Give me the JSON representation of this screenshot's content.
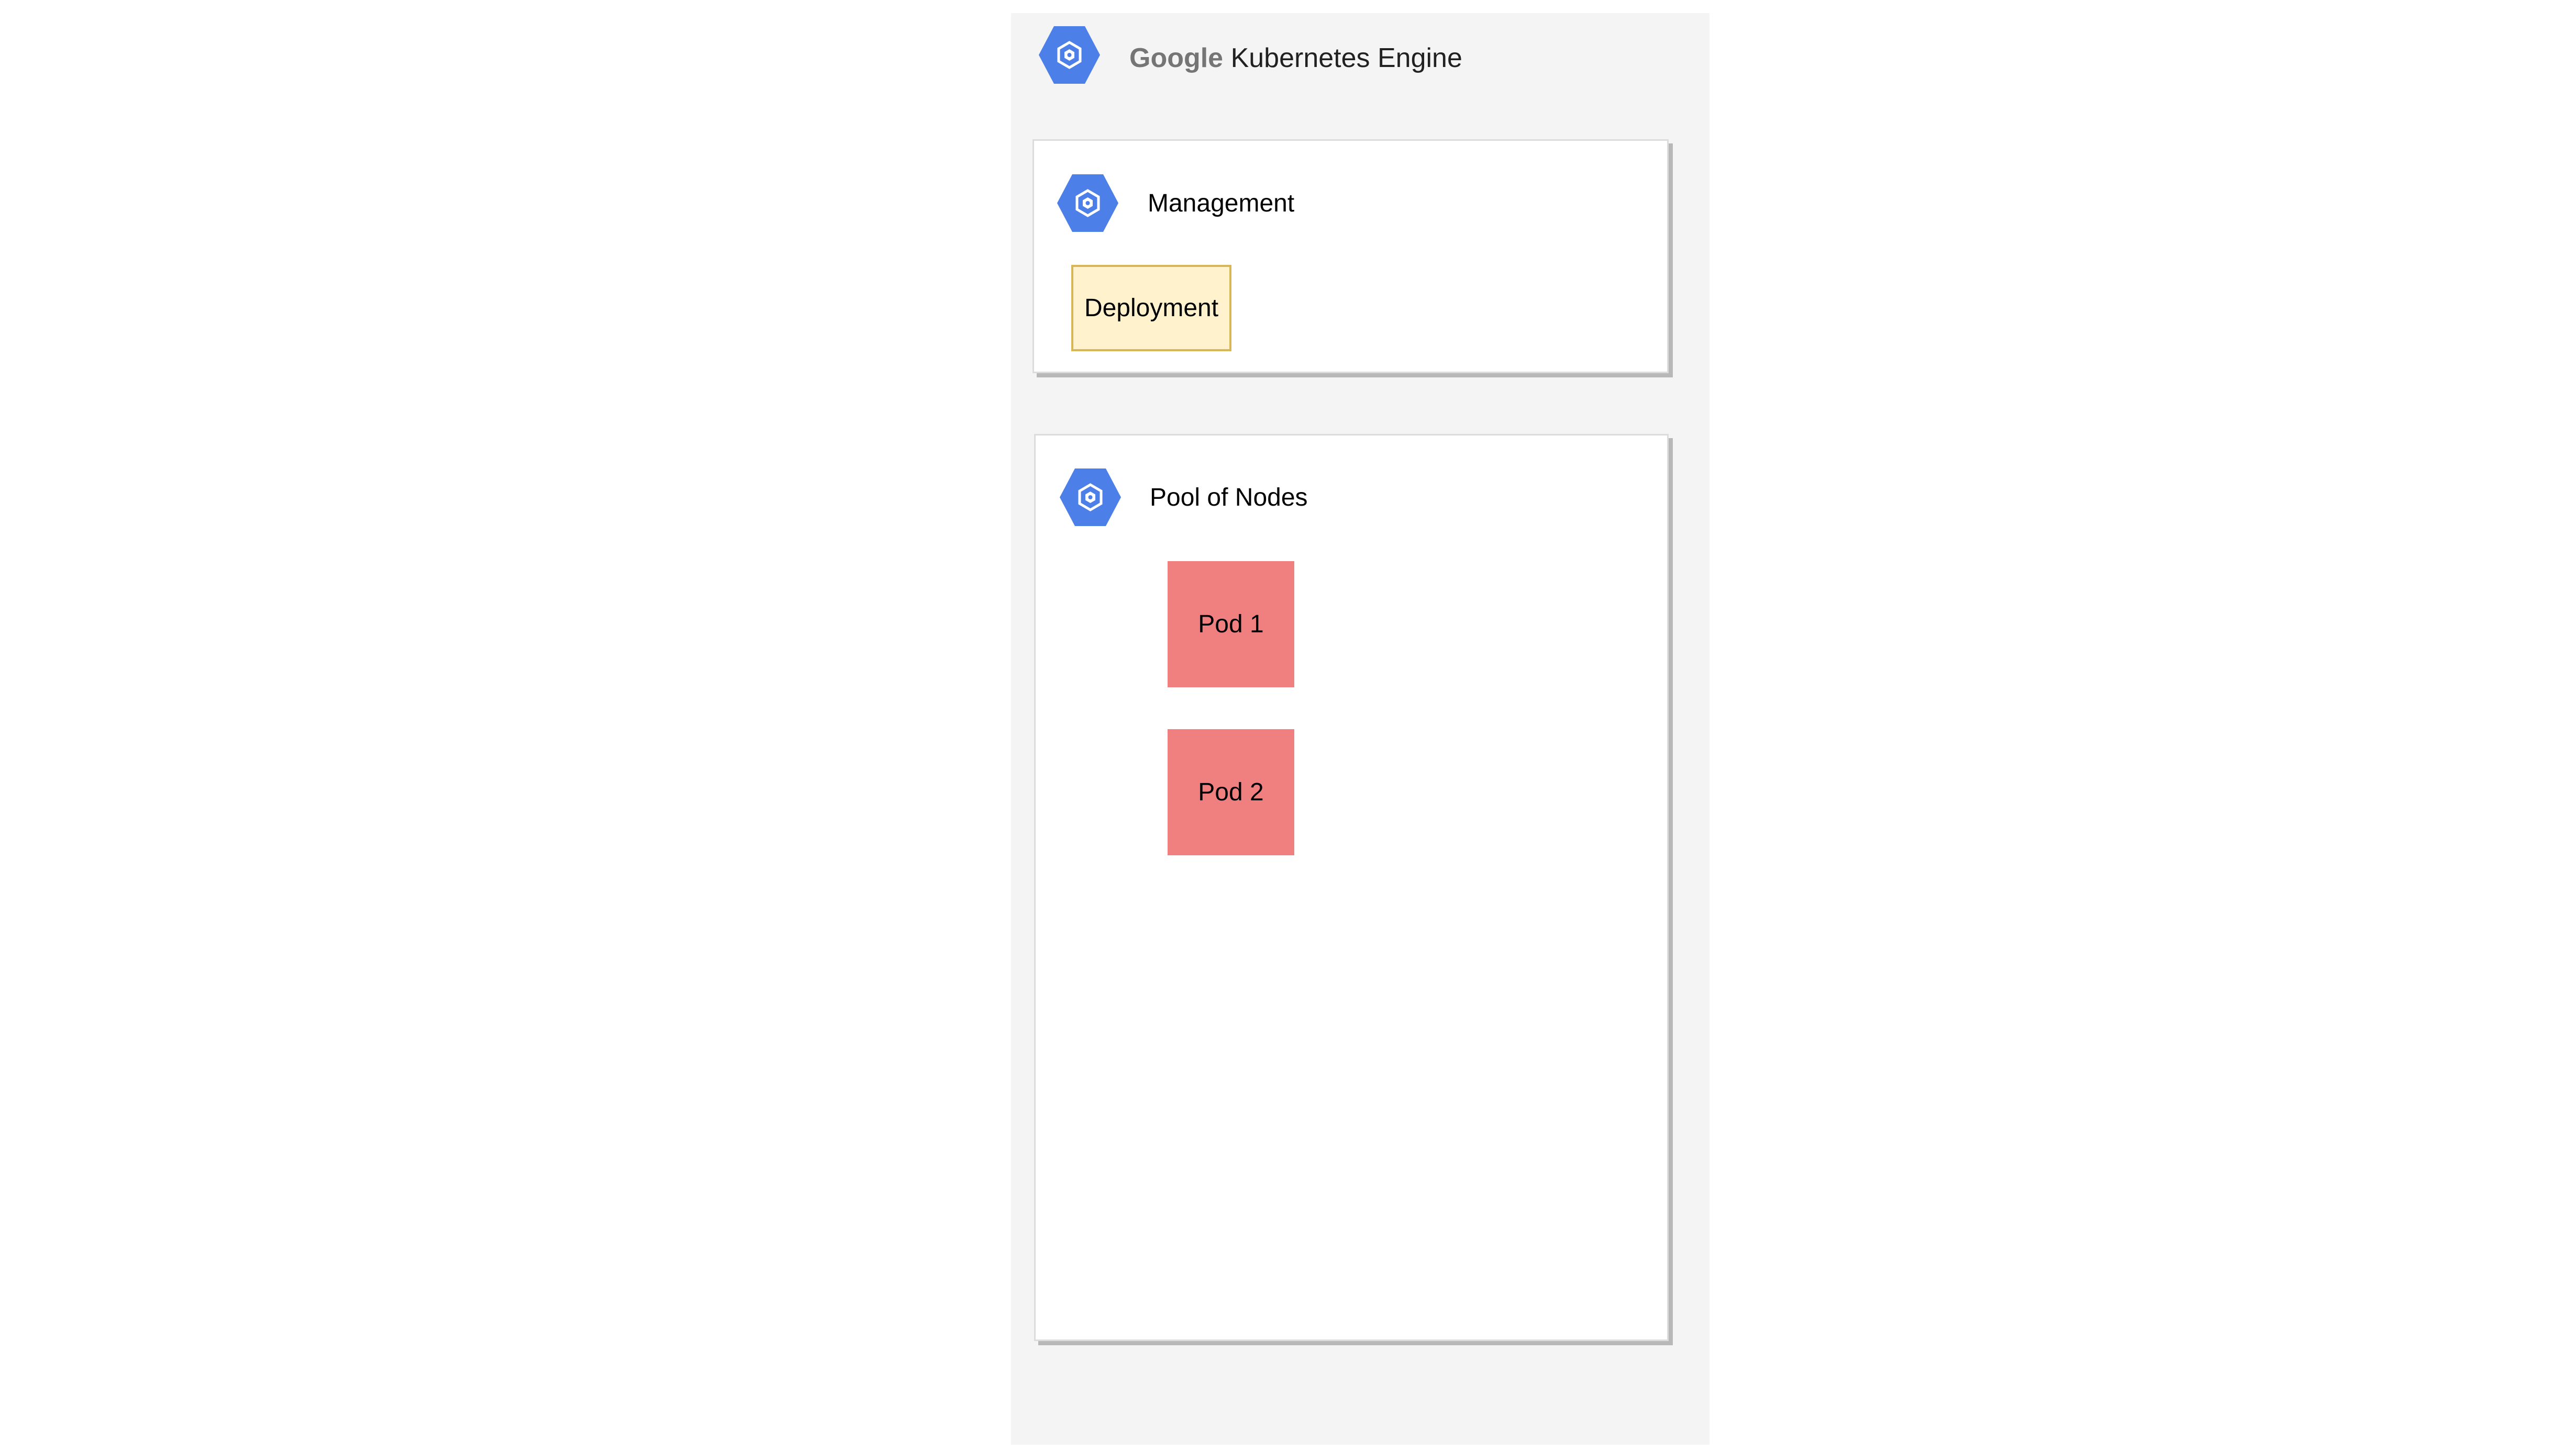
{
  "colors": {
    "frame_background": "#f4f4f4",
    "hexagon_blue": "#4d7fe8",
    "deployment_fill": "#fff2cc",
    "deployment_border": "#d6b656",
    "pod_fill": "#f08080",
    "brand_gray": "#757575"
  },
  "gke": {
    "icon": "kubernetes-engine-icon",
    "brand": "Google",
    "product": "Kubernetes Engine"
  },
  "management": {
    "icon": "kubernetes-engine-icon",
    "label": "Management",
    "deployment_label": "Deployment"
  },
  "pool": {
    "icon": "kubernetes-engine-icon",
    "label": "Pool of Nodes",
    "pods": [
      {
        "label": "Pod 1"
      },
      {
        "label": "Pod 2"
      }
    ]
  }
}
